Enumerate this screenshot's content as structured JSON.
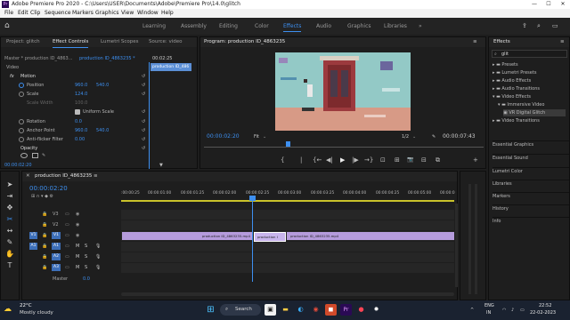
{
  "window": {
    "title": "Adobe Premiere Pro 2020 - C:\\Users\\USER\\Documents\\Adobe\\Premiere Pro\\14.0\\glitch",
    "app_icon": "Pr",
    "minimize": "—",
    "maximize": "☐",
    "close": "✕"
  },
  "menu": [
    "File",
    "Edit",
    "Clip",
    "Sequence",
    "Markers",
    "Graphics",
    "View",
    "Window",
    "Help"
  ],
  "workspaces": {
    "tabs": [
      "Learning",
      "Assembly",
      "Editing",
      "Color",
      "Effects",
      "Audio",
      "Graphics",
      "Libraries"
    ],
    "active": "Effects",
    "more": "»"
  },
  "effect_controls": {
    "tabs": [
      "Project: glitch",
      "Effect Controls",
      "Lumetri Scopes",
      "Source: video"
    ],
    "source_label": "Master * production ID_4863...",
    "clip_label": "production ID_4863235 *",
    "timecode_start": "00:02:25",
    "mini_clip": "production ID_486",
    "section": "Video",
    "fx": "fx",
    "motion": "Motion",
    "rows": [
      {
        "label": "Position",
        "v1": "960.0",
        "v2": "540.0"
      },
      {
        "label": "Scale",
        "v1": "124.0",
        "v2": ""
      },
      {
        "label": "Scale Width",
        "v1": "100.0",
        "v2": ""
      },
      {
        "label": "Uniform Scale",
        "v1": "",
        "v2": ""
      },
      {
        "label": "Rotation",
        "v1": "0.0",
        "v2": ""
      },
      {
        "label": "Anchor Point",
        "v1": "960.0",
        "v2": "540.0"
      },
      {
        "label": "Anti-flicker Filter",
        "v1": "0.00",
        "v2": ""
      }
    ],
    "opacity": "Opacity",
    "footer_time": "00:00:02:20"
  },
  "program": {
    "title": "Program: production ID_4863235",
    "timecode": "00:00:02:20",
    "fit": "Fit",
    "quality": "1/2",
    "duration": "00:00:07:43",
    "controls": [
      "{",
      "|",
      "{←",
      "◀|",
      "▶",
      "|▶",
      "→}",
      "⊡",
      "⊞",
      "📷",
      "⊟",
      "⧉",
      "+"
    ]
  },
  "effects_panel": {
    "title": "Effects",
    "search_value": "glit",
    "tree": [
      {
        "label": "Presets",
        "level": 0
      },
      {
        "label": "Lumetri Presets",
        "level": 0
      },
      {
        "label": "Audio Effects",
        "level": 0
      },
      {
        "label": "Audio Transitions",
        "level": 0
      },
      {
        "label": "Video Effects",
        "level": 0
      },
      {
        "label": "Immersive Video",
        "level": 1
      },
      {
        "label": "VR Digital Glitch",
        "level": 2
      },
      {
        "label": "Video Transitions",
        "level": 0
      }
    ],
    "stack": [
      "Essential Graphics",
      "Essential Sound",
      "Lumetri Color",
      "Libraries",
      "Markers",
      "History",
      "Info"
    ]
  },
  "timeline": {
    "title": "production ID_4863235",
    "timecode": "00:00:02:20",
    "ruler": [
      ":00:00:25",
      "00:00:01:00",
      "00:00:01:25",
      "00:00:02:00",
      "00:00:02:25",
      "00:00:03:00",
      "00:00:03:25",
      "00:00:04:00",
      "00:00:04:25",
      "00:00:05:00",
      "00:00:0"
    ],
    "tracks": [
      {
        "name": "V3",
        "kind": "video"
      },
      {
        "name": "V2",
        "kind": "video"
      },
      {
        "name": "V1",
        "kind": "video",
        "target": "V1"
      },
      {
        "name": "A1",
        "kind": "audio",
        "target": "A1"
      },
      {
        "name": "A2",
        "kind": "audio"
      },
      {
        "name": "A3",
        "kind": "audio"
      }
    ],
    "mix_label": "Master",
    "mix_value": "0.0",
    "clips": [
      {
        "label": "production ID_4863235.mp4"
      },
      {
        "label": "production I"
      },
      {
        "label": "production ID_4863235.mp4"
      }
    ],
    "m": "M",
    "s": "S"
  },
  "taskbar": {
    "weather_temp": "22°C",
    "weather_desc": "Mostly cloudy",
    "search": "Search",
    "lang1": "ENG",
    "lang2": "IN",
    "time": "22:52",
    "date": "22-02-2023"
  },
  "colors": {
    "accent": "#3d8ff0",
    "clip": "#b59bdc",
    "playhead": "#3d8ff0"
  }
}
